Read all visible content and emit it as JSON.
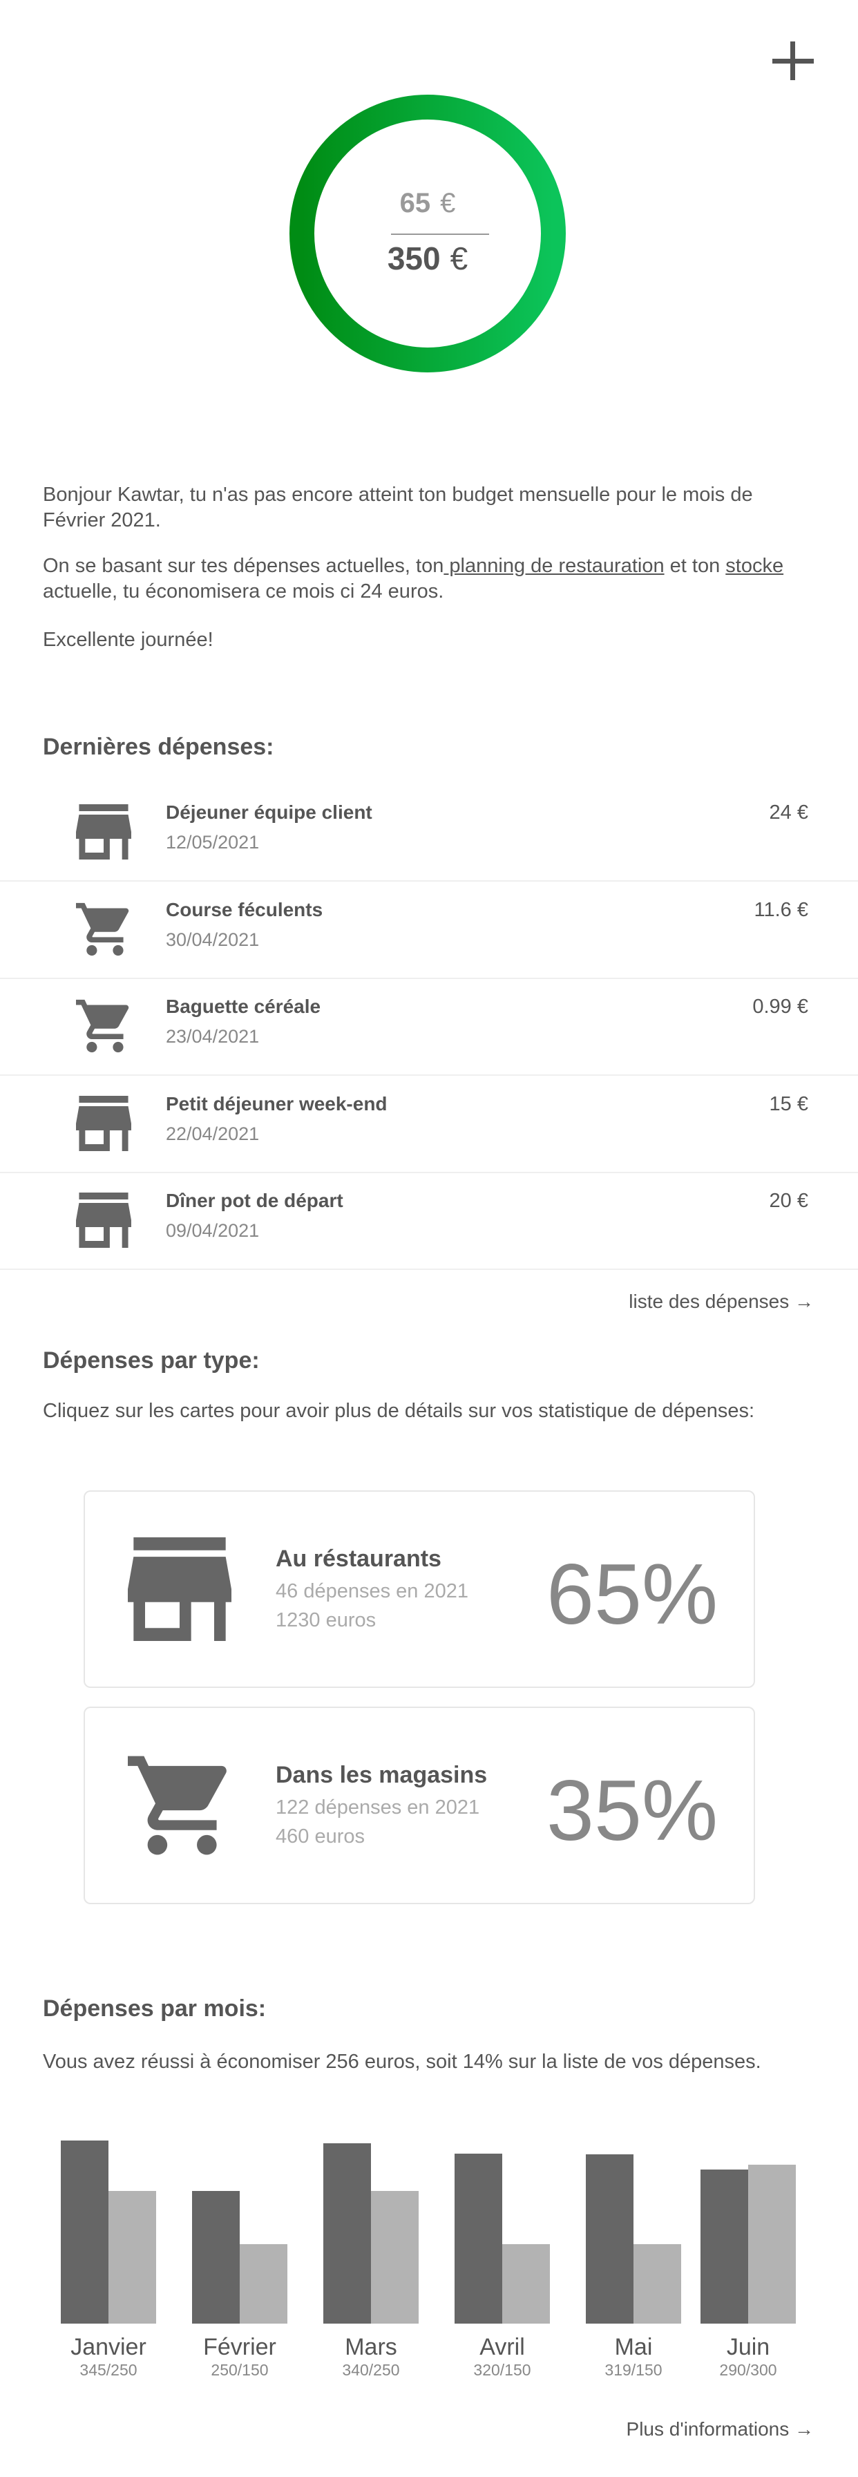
{
  "header": {
    "add_icon": "plus-icon"
  },
  "budget": {
    "spent": "65",
    "total": "350",
    "currency": "€",
    "ring_colors": [
      "#008c14",
      "#0cc45a"
    ]
  },
  "intro": {
    "p1": "Bonjour Kawtar, tu n'as pas encore atteint ton budget mensuelle pour le mois de Février 2021.",
    "p2_a": "On se basant sur tes dépenses actuelles, ton",
    "p2_link1": " planning de restauration",
    "p2_b": " et ton ",
    "p2_link2": "stocke",
    "p2_c": " actuelle, tu économisera ce mois ci 24 euros.",
    "p3": "Excellente journée!"
  },
  "recent": {
    "title": "Dernières dépenses:",
    "items": [
      {
        "icon": "store-icon",
        "title": "Déjeuner équipe client",
        "date": "12/05/2021",
        "amount": "24 €"
      },
      {
        "icon": "cart-icon",
        "title": "Course féculents",
        "date": "30/04/2021",
        "amount": "11.6 €"
      },
      {
        "icon": "cart-icon",
        "title": "Baguette céréale",
        "date": "23/04/2021",
        "amount": "0.99 €"
      },
      {
        "icon": "store-icon",
        "title": "Petit déjeuner week-end",
        "date": "22/04/2021",
        "amount": "15 €"
      },
      {
        "icon": "store-icon",
        "title": "Dîner pot de départ",
        "date": "09/04/2021",
        "amount": "20 €"
      }
    ],
    "link": "liste des dépenses →"
  },
  "by_type": {
    "title": "Dépenses par type:",
    "desc": "Cliquez sur les cartes pour avoir plus de détails sur vos statistique de dépenses:",
    "cards": [
      {
        "icon": "store-icon",
        "title": "Au réstaurants",
        "count": "46 dépenses en 2021",
        "total": "1230 euros",
        "percent": "65%"
      },
      {
        "icon": "cart-icon",
        "title": "Dans les magasins",
        "count": "122 dépenses en 2021",
        "total": "460 euros",
        "percent": "35%"
      }
    ]
  },
  "by_month": {
    "title": "Dépenses par mois:",
    "desc": "Vous avez réussi à économiser 256 euros, soit 14% sur la liste de vos dépenses.",
    "link": "Plus d'informations →"
  },
  "chart_data": {
    "type": "bar",
    "categories": [
      "Janvier",
      "Février",
      "Mars",
      "Avril",
      "Mai",
      "Juin"
    ],
    "labels": [
      "345/250",
      "250/150",
      "340/250",
      "320/150",
      "319/150",
      "290/300"
    ],
    "series": [
      {
        "values": [
          345,
          250,
          340,
          320,
          319,
          290
        ],
        "color": "#666666"
      },
      {
        "values": [
          250,
          150,
          250,
          150,
          150,
          300
        ],
        "color": "#b3b3b3"
      }
    ],
    "grid": false
  }
}
